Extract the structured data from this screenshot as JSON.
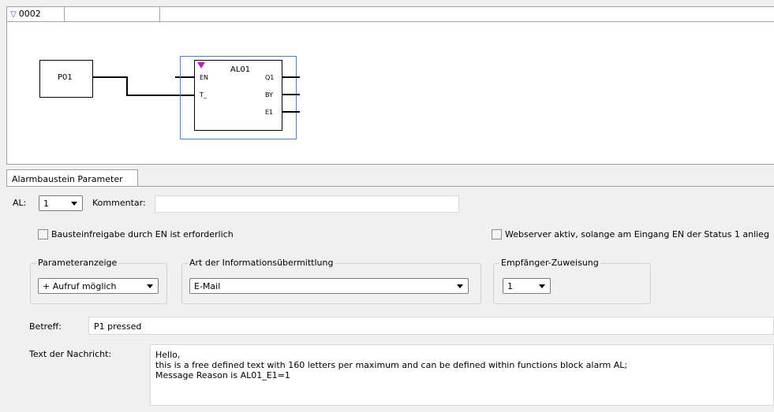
{
  "diagram": {
    "rung_label": "0002",
    "input_block": "P01",
    "alarm_block": {
      "title": "AL01",
      "inputs": [
        "EN",
        "T_"
      ],
      "outputs": [
        "Q1",
        "BY",
        "E1"
      ]
    }
  },
  "tab": {
    "label": "Alarmbaustein Parameter"
  },
  "params": {
    "al_label": "AL:",
    "al_value": "1",
    "comment_label": "Kommentar:",
    "comment_value": "",
    "enable_checkbox_label": "Bausteinfreigabe durch EN ist erforderlich",
    "webserver_checkbox_label": "Webserver aktiv, solange am Eingang EN der Status 1 anlieg",
    "group_display": {
      "title": "Parameteranzeige",
      "value": "+ Aufruf möglich"
    },
    "group_info": {
      "title": "Art der Informationsübermittlung",
      "value": "E-Mail"
    },
    "group_recipient": {
      "title": "Empfänger-Zuweisung",
      "value": "1"
    },
    "subject_label": "Betreff:",
    "subject_value": "P1 pressed",
    "message_label": "Text der Nachricht:",
    "message_line1": "Hello,",
    "message_line2": "this is a free defined text with 160 letters per maximum and can be defined within functions block alarm AL;",
    "message_line3": "Message Reason is AL01_E1=1"
  },
  "colors": {
    "selection_border": "#4a7fd4",
    "en_marker": "#c020c0",
    "rung_triangle": "#3050c0"
  }
}
